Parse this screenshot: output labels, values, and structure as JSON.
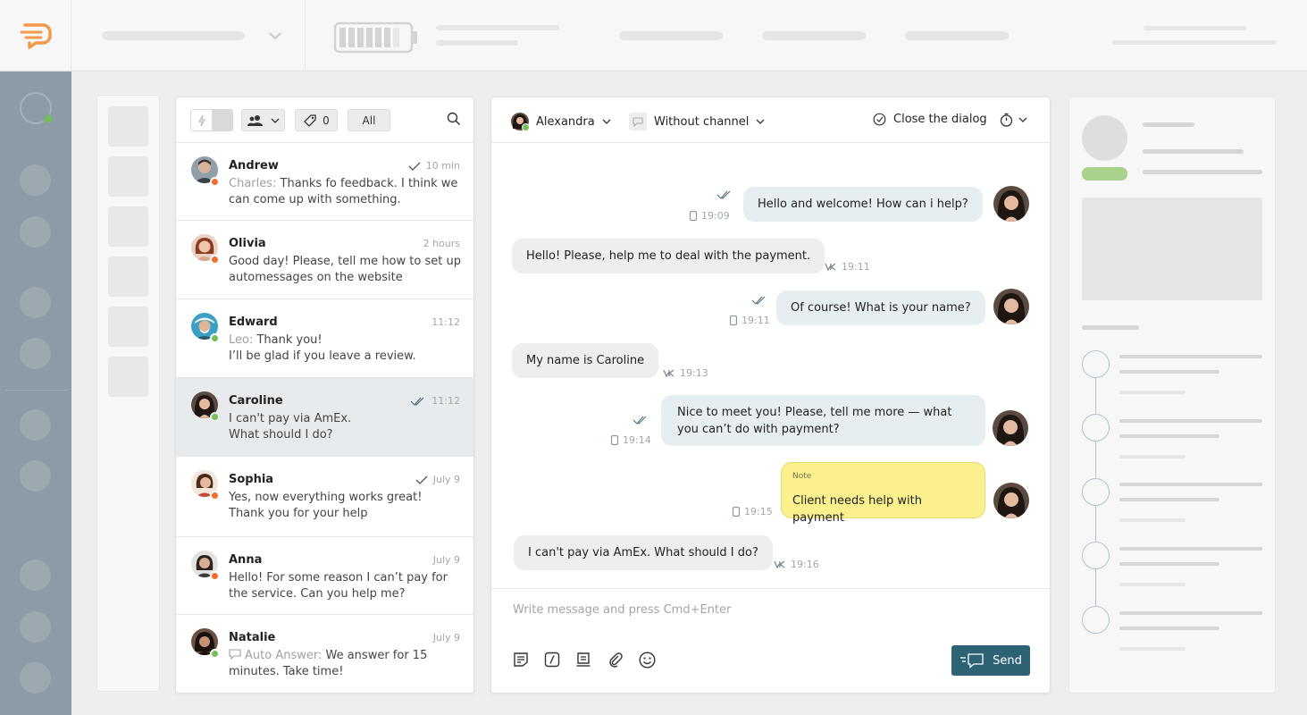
{
  "colors": {
    "accent_orange": "#f2994a",
    "rail": "#8c9ba5",
    "send_button": "#2e6376",
    "online": "#71c156",
    "away": "#f26a2e",
    "note_bg": "#fbf08e"
  },
  "list_toolbar": {
    "tags_count": "0",
    "filter_label": "All"
  },
  "dialogs": [
    {
      "name": "Andrew",
      "time": "10 min",
      "who": "Charles:",
      "text": " Thanks fo feedback. I think we can come up with something.",
      "status": "away",
      "read": "single",
      "icon": ""
    },
    {
      "name": "Olivia",
      "time": "2 hours",
      "who": "",
      "text": "Good day! Please, tell me how to set up automessages on the website",
      "status": "away",
      "read": "",
      "icon": ""
    },
    {
      "name": "Edward",
      "time": "11:12",
      "who": "Leo:",
      "text": " Thank you!\nI’ll be glad if you leave a review.",
      "status": "online",
      "read": "",
      "icon": ""
    },
    {
      "name": "Caroline",
      "time": "11:12",
      "who": "",
      "text": "I can't pay via AmEx.\nWhat should I do?",
      "status": "online",
      "read": "double",
      "icon": ""
    },
    {
      "name": "Sophia",
      "time": "July 9",
      "who": "",
      "text": "Yes, now everything works great!\nThank you for your help",
      "status": "away",
      "read": "single",
      "icon": ""
    },
    {
      "name": "Anna",
      "time": "July 9",
      "who": "",
      "text": "Hello! For some reason I can’t pay for the service. Can you help me?",
      "status": "away",
      "read": "",
      "icon": ""
    },
    {
      "name": "Natalie",
      "time": "July 9",
      "who": "Auto Answer:",
      "text": " We answer for 15 minutes. Take time!",
      "status": "online",
      "read": "",
      "icon": "chat-bubble-icon"
    }
  ],
  "chat_header": {
    "operator": "Alexandra",
    "channel": "Without channel",
    "close": "Close the dialog"
  },
  "messages": [
    {
      "dir": "out",
      "text": "Hello and welcome! How can i help?",
      "time": "19:09"
    },
    {
      "dir": "in",
      "text": "Hello! Please, help me to deal with the payment.",
      "time": "19:11"
    },
    {
      "dir": "out",
      "text": "Of course! What is your name?",
      "time": "19:11"
    },
    {
      "dir": "in",
      "text": "My name is Caroline",
      "time": "19:13"
    },
    {
      "dir": "out",
      "text": "Nice to meet you! Please, tell me more — what you can’t do with payment?",
      "time": "19:14"
    },
    {
      "dir": "note",
      "label": "Note",
      "text": "Client needs help with payment",
      "time": "19:15"
    },
    {
      "dir": "in",
      "text": "I can't pay via AmEx. What should I do?",
      "time": "19:16"
    }
  ],
  "composer": {
    "placeholder": "Write message and press Cmd+Enter",
    "send_label": "Send"
  }
}
